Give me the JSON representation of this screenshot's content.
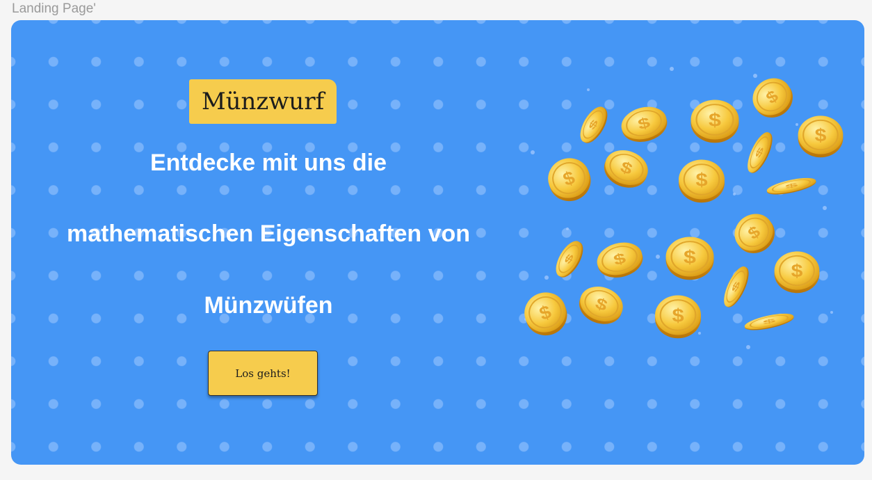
{
  "frame": {
    "label": "Landing Page'"
  },
  "hero": {
    "brand": "Münzwurf",
    "headline": [
      "Entdecke mit uns die",
      "mathematischen Eigenschaften von",
      "Münzwüfen"
    ],
    "cta_label": "Los gehts!",
    "illustration": "falling-gold-coins-illustration"
  },
  "colors": {
    "page_background": "#f5f5f5",
    "hero_background": "#4596f5",
    "accent_yellow": "#f6cc4d",
    "headline_text": "#ffffff"
  }
}
